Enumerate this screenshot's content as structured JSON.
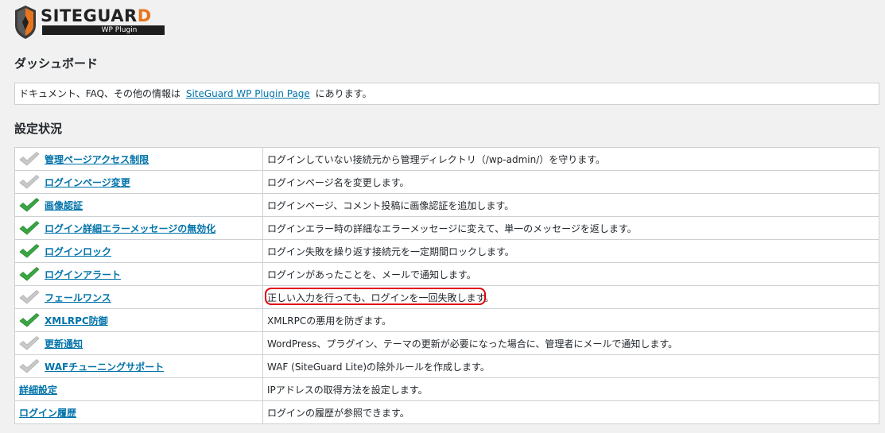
{
  "logo": {
    "name_main": "SITEGUAR",
    "name_last": "D",
    "sub": "WP Plugin"
  },
  "dashboard": {
    "title": "ダッシュボード",
    "notice_before": "ドキュメント、FAQ、その他の情報は",
    "notice_link": "SiteGuard WP Plugin Page",
    "notice_after": "にあります。"
  },
  "status": {
    "title": "設定状況",
    "rows": [
      {
        "label": "管理ページアクセス制限",
        "desc": "ログインしていない接続元から管理ディレクトリ（/wp-admin/）を守ります。",
        "state": "off"
      },
      {
        "label": "ログインページ変更",
        "desc": "ログインページ名を変更します。",
        "state": "off"
      },
      {
        "label": "画像認証",
        "desc": "ログインページ、コメント投稿に画像認証を追加します。",
        "state": "on"
      },
      {
        "label": "ログイン詳細エラーメッセージの無効化",
        "desc": "ログインエラー時の詳細なエラーメッセージに変えて、単一のメッセージを返します。",
        "state": "on"
      },
      {
        "label": "ログインロック",
        "desc": "ログイン失敗を繰り返す接続元を一定期間ロックします。",
        "state": "on"
      },
      {
        "label": "ログインアラート",
        "desc": "ログインがあったことを、メールで通知します。",
        "state": "on"
      },
      {
        "label": "フェールワンス",
        "desc": "正しい入力を行っても、ログインを一回失敗します。",
        "state": "off",
        "highlight": true
      },
      {
        "label": "XMLRPC防御",
        "desc": "XMLRPCの悪用を防ぎます。",
        "state": "on"
      },
      {
        "label": "更新通知",
        "desc": "WordPress、プラグイン、テーマの更新が必要になった場合に、管理者にメールで通知します。",
        "state": "off"
      },
      {
        "label": "WAFチューニングサポート",
        "desc": "WAF (SiteGuard Lite)の除外ルールを作成します。",
        "state": "off"
      },
      {
        "label": "詳細設定",
        "desc": "IPアドレスの取得方法を設定します。",
        "state": "none"
      },
      {
        "label": "ログイン履歴",
        "desc": "ログインの履歴が参照できます。",
        "state": "none"
      }
    ]
  },
  "colors": {
    "check_on": "#3aa544",
    "check_off": "#c8c8c8",
    "link": "#0073aa",
    "highlight": "#e0000a"
  }
}
